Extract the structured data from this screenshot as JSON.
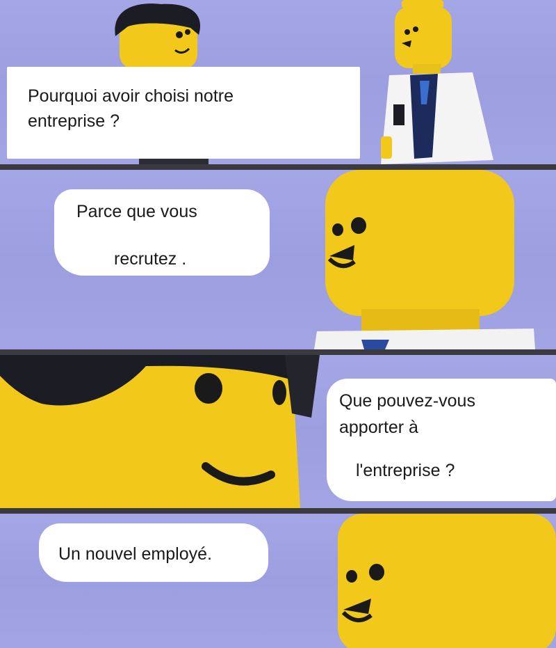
{
  "colors": {
    "background": "#a4a6e6",
    "bubble": "#ffffff",
    "text": "#1a1a1a",
    "lego_yellow": "#f2c91a",
    "hair": "#1c1c24",
    "divider": "#3a3a40"
  },
  "panels": [
    {
      "bubble_lines": [
        "Pourquoi avoir choisi notre",
        "entreprise ?"
      ],
      "characters": [
        "lego-recruiter-figure",
        "lego-candidate-figure-lab-coat"
      ]
    },
    {
      "bubble_lines": [
        "Parce que vous",
        "recrutez ."
      ],
      "characters": [
        "lego-candidate-head"
      ]
    },
    {
      "bubble_lines": [
        "Que pouvez-vous",
        "apporter à",
        "l'entreprise ?"
      ],
      "characters": [
        "lego-recruiter-head-closeup"
      ]
    },
    {
      "bubble_lines": [
        "Un nouvel employé."
      ],
      "characters": [
        "lego-candidate-head"
      ]
    }
  ]
}
